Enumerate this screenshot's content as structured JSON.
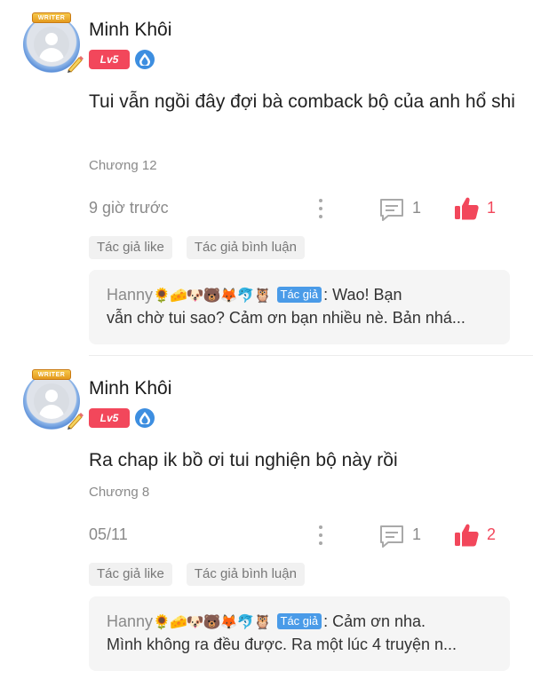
{
  "comments": [
    {
      "user_name": "Minh Khôi",
      "avatar_banner": "WRITER",
      "level": "Lv5",
      "text": "Tui vẫn ngồi đây đợi bà comback bộ của anh hổ shi",
      "chapter": "Chương 12",
      "time": "9 giờ trước",
      "reply_count": "1",
      "like_count": "1",
      "tags": [
        "Tác giả like",
        "Tác giả bình luận"
      ],
      "reply": {
        "author": "Hanny",
        "emojis": "🌻🧀🐶🐻🦊🐬🦉",
        "author_tag": "Tác giả",
        "line1": ": Wao! Bạn",
        "line2": "vẫn chờ tui sao? Cảm ơn bạn nhiều nè. Bản nhá..."
      }
    },
    {
      "user_name": "Minh Khôi",
      "avatar_banner": "WRITER",
      "level": "Lv5",
      "text": "Ra chap ik bồ ơi tui nghiện bộ này rồi",
      "chapter": "Chương 8",
      "time": "05/11",
      "reply_count": "1",
      "like_count": "2",
      "tags": [
        "Tác giả like",
        "Tác giả bình luận"
      ],
      "reply": {
        "author": "Hanny",
        "emojis": "🌻🧀🐶🐻🦊🐬🦉",
        "author_tag": "Tác giả",
        "line1": ": Cảm ơn nha.",
        "line2": "Mình không ra đều được. Ra một lúc 4 truyện n..."
      }
    }
  ],
  "colors": {
    "accent_like": "#f2475b",
    "level_badge": "#f2475b",
    "author_tag": "#4a9be8",
    "muted_text": "#8a8a8a"
  },
  "icons": [
    "avatar-placeholder-icon",
    "writer-pen-icon",
    "water-drop-icon",
    "more-vertical-icon",
    "comment-icon",
    "thumbs-up-icon"
  ]
}
